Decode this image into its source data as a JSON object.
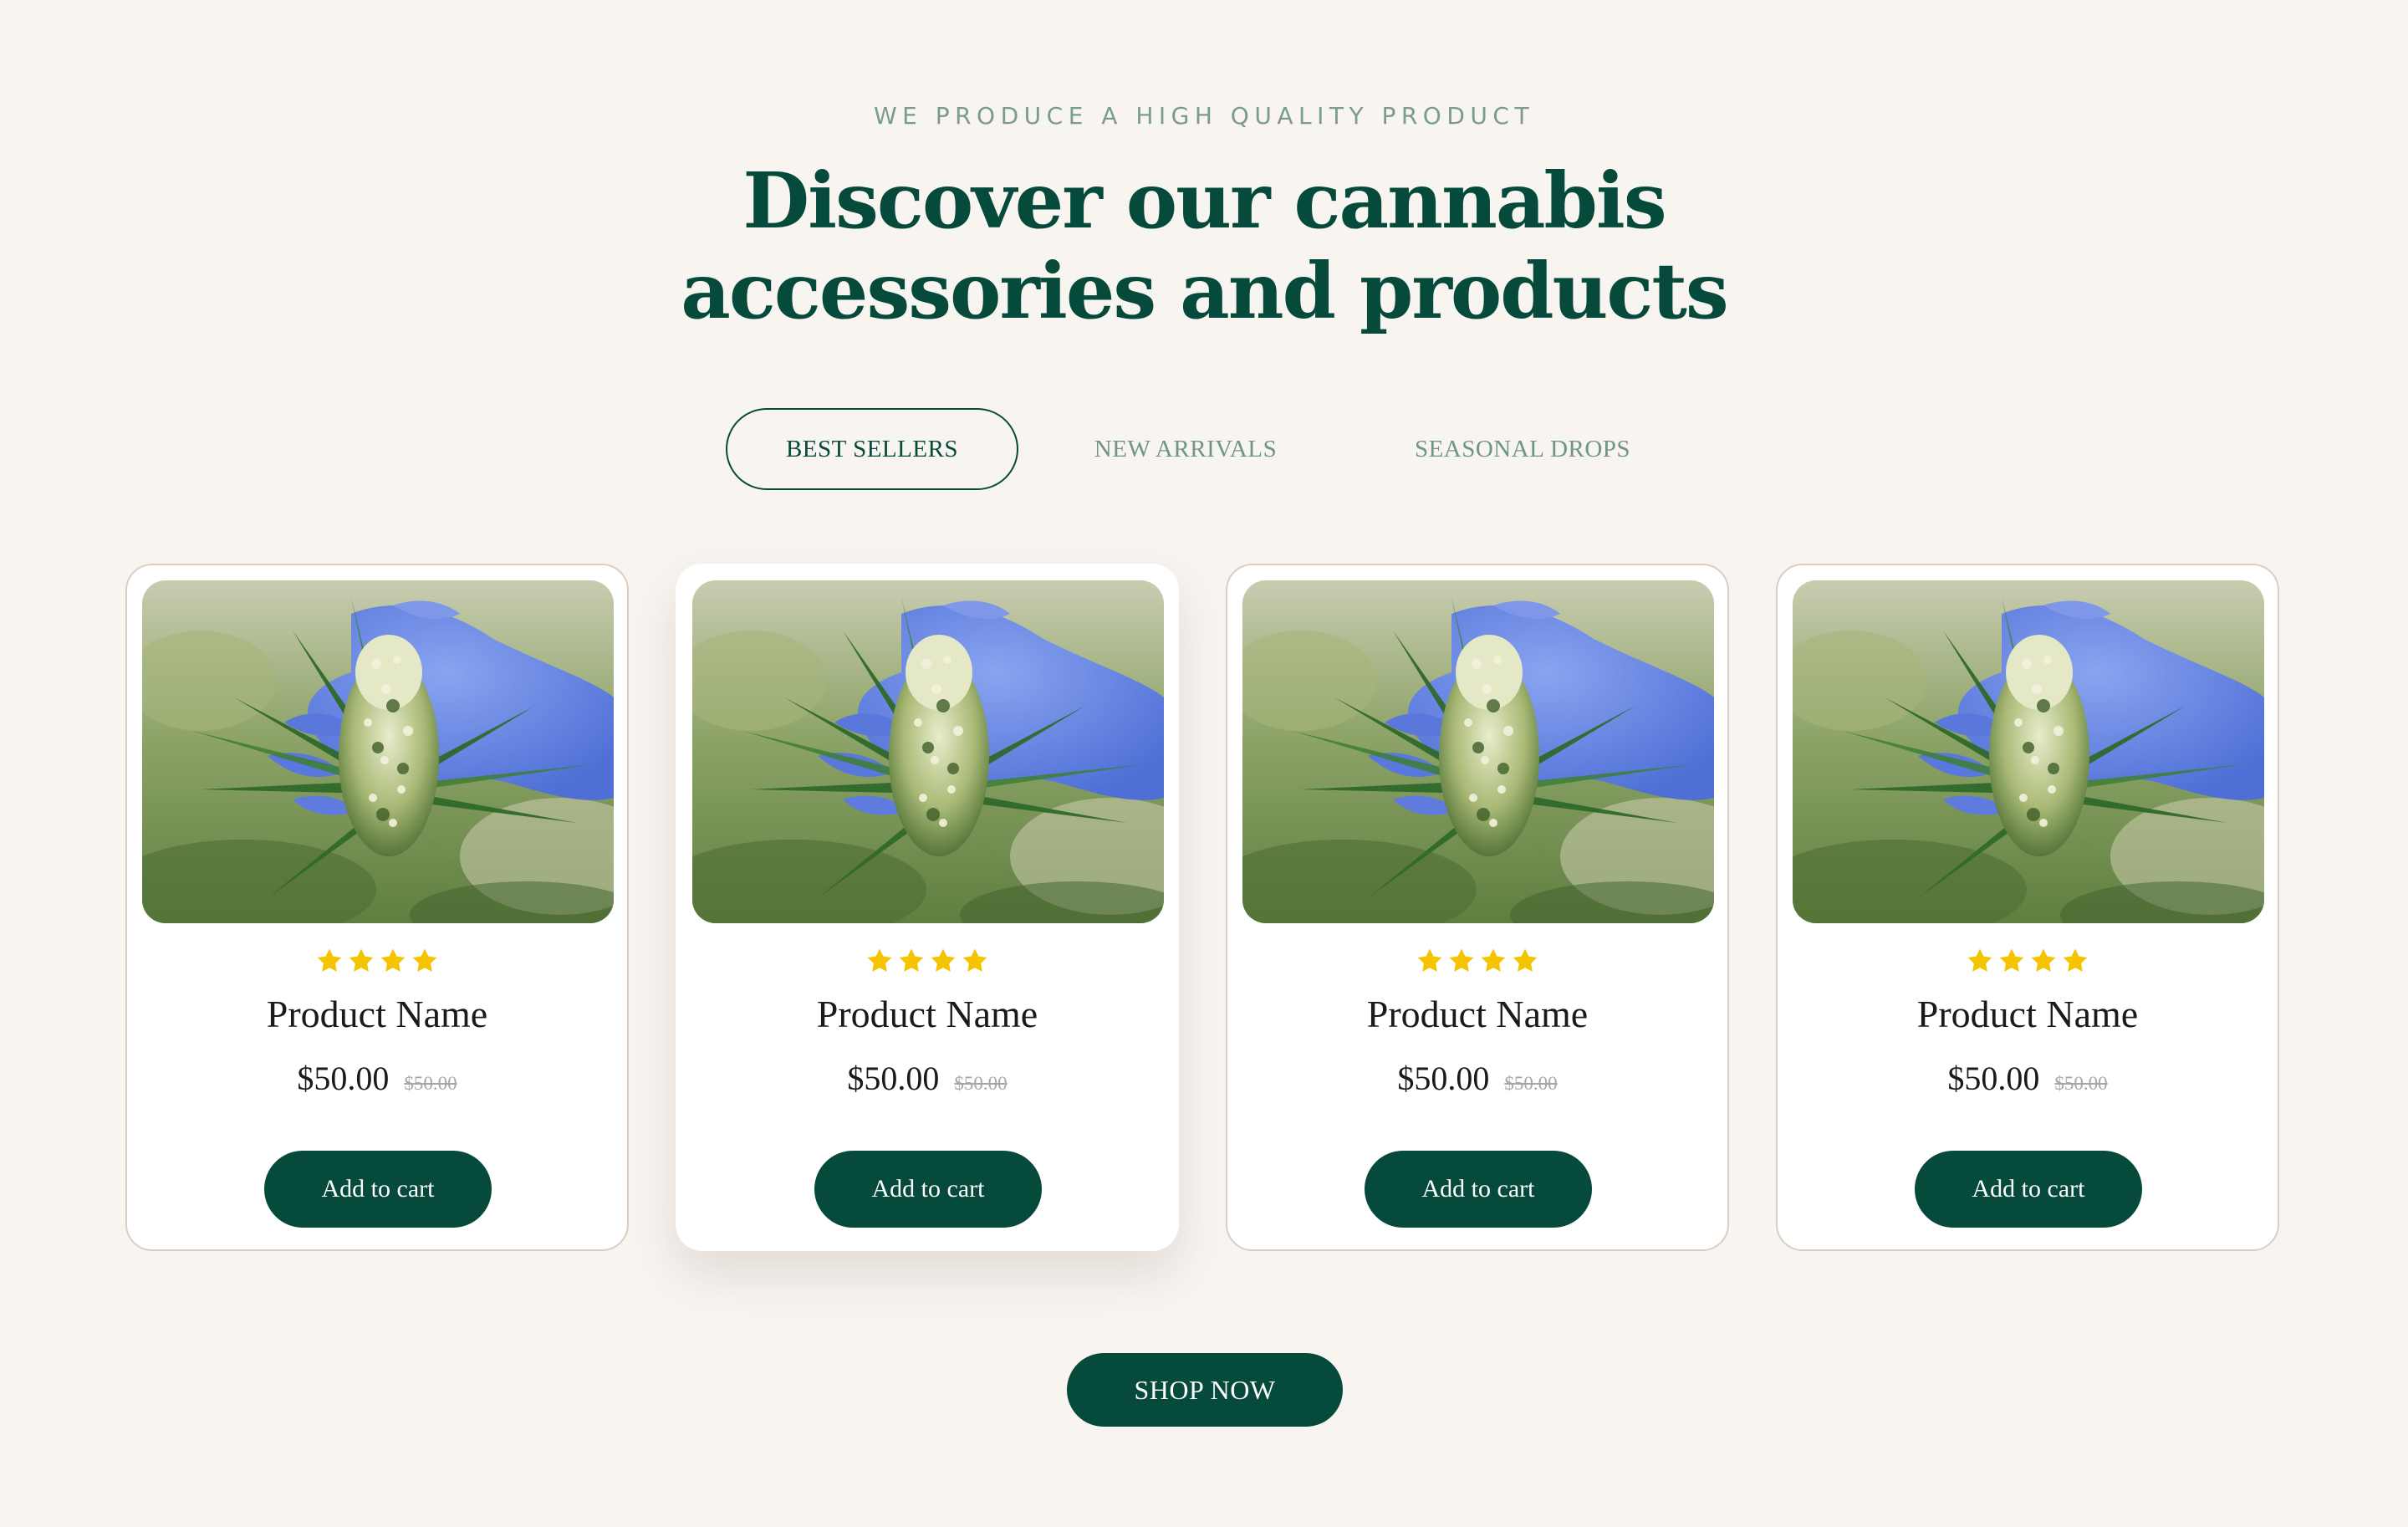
{
  "section": {
    "eyebrow": "WE PRODUCE A HIGH QUALITY PRODUCT",
    "title_line1": "Discover our cannabis",
    "title_line2": "accessories and products"
  },
  "tabs": [
    {
      "label": "BEST SELLERS",
      "active": true
    },
    {
      "label": "NEW ARRIVALS",
      "active": false
    },
    {
      "label": "SEASONAL DROPS",
      "active": false
    }
  ],
  "products": [
    {
      "name": "Product Name",
      "price": "$50.00",
      "old_price": "$50.00",
      "rating": 4,
      "cta": "Add to cart",
      "image": "cannabis-plant-gloved-hand"
    },
    {
      "name": "Product Name",
      "price": "$50.00",
      "old_price": "$50.00",
      "rating": 4,
      "cta": "Add to cart",
      "image": "cannabis-plant-gloved-hand"
    },
    {
      "name": "Product Name",
      "price": "$50.00",
      "old_price": "$50.00",
      "rating": 4,
      "cta": "Add to cart",
      "image": "cannabis-plant-gloved-hand"
    },
    {
      "name": "Product Name",
      "price": "$50.00",
      "old_price": "$50.00",
      "rating": 4,
      "cta": "Add to cart",
      "image": "cannabis-plant-gloved-hand"
    }
  ],
  "shop_button": "SHOP NOW",
  "colors": {
    "background": "#f8f4f0",
    "primary": "#054a3b",
    "muted_green": "#7a9c8d",
    "star": "#f5c400",
    "card_border": "#dccdc2"
  }
}
